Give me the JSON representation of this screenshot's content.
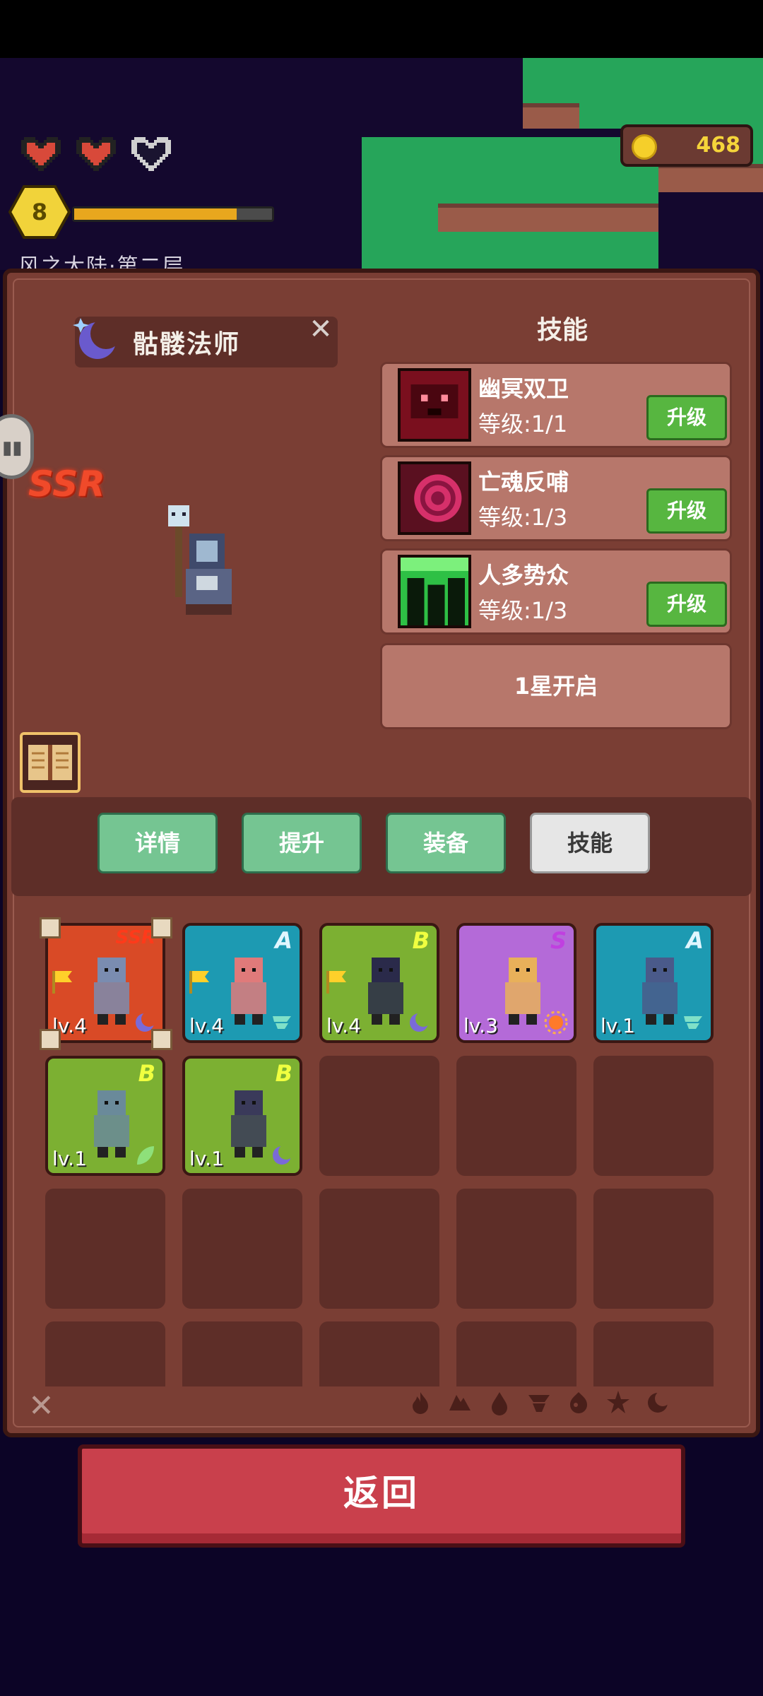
{
  "hud": {
    "hearts": [
      "full",
      "full",
      "empty"
    ],
    "player_level": "8",
    "xp_progress": 0.82,
    "stage_name": "风之大陆·第二层",
    "coins": "468"
  },
  "hero": {
    "name": "骷髅法师",
    "rarity": "SSR",
    "element_icon": "moon-star-icon"
  },
  "skills_panel": {
    "title": "技能",
    "upgrade_label": "升级",
    "skills": [
      {
        "name": "幽冥双卫",
        "level": "等级:1/1",
        "icon": "twin-guards-icon",
        "color": "#7a0f1e"
      },
      {
        "name": "亡魂反哺",
        "level": "等级:1/3",
        "icon": "spiral-soul-icon",
        "color": "#d6306a"
      },
      {
        "name": "人多势众",
        "level": "等级:1/3",
        "icon": "crowd-icon",
        "color": "#2ec045"
      }
    ],
    "locked_slot": "1星开启"
  },
  "tabs": [
    {
      "label": "详情",
      "active": false
    },
    {
      "label": "提升",
      "active": false
    },
    {
      "label": "装备",
      "active": false
    },
    {
      "label": "技能",
      "active": true
    }
  ],
  "inventory": [
    {
      "rank": "SSR",
      "level": "lv.4",
      "bg": "#d94a26",
      "rank_color": "#ff3a1a",
      "flag": true,
      "element": "moon",
      "selected": true
    },
    {
      "rank": "A",
      "level": "lv.4",
      "bg": "#1d9ab2",
      "rank_color": "#e0f6ff",
      "flag": true,
      "element": "wind"
    },
    {
      "rank": "B",
      "level": "lv.4",
      "bg": "#7cb032",
      "rank_color": "#f0ff40",
      "flag": true,
      "element": "moon"
    },
    {
      "rank": "S",
      "level": "lv.3",
      "bg": "#b46ad8",
      "rank_color": "#c040e0",
      "flag": false,
      "element": "sun"
    },
    {
      "rank": "A",
      "level": "lv.1",
      "bg": "#1d9ab2",
      "rank_color": "#e0f6ff",
      "flag": false,
      "element": "wind"
    },
    {
      "rank": "B",
      "level": "lv.1",
      "bg": "#7cb032",
      "rank_color": "#f0ff40",
      "flag": false,
      "element": "leaf"
    },
    {
      "rank": "B",
      "level": "lv.1",
      "bg": "#7cb032",
      "rank_color": "#f0ff40",
      "flag": false,
      "element": "moon"
    }
  ],
  "filter_icons": [
    "fire-icon",
    "earth-icon",
    "water-icon",
    "wind-icon",
    "poison-icon",
    "holy-icon",
    "dark-icon"
  ],
  "back_label": "返回"
}
